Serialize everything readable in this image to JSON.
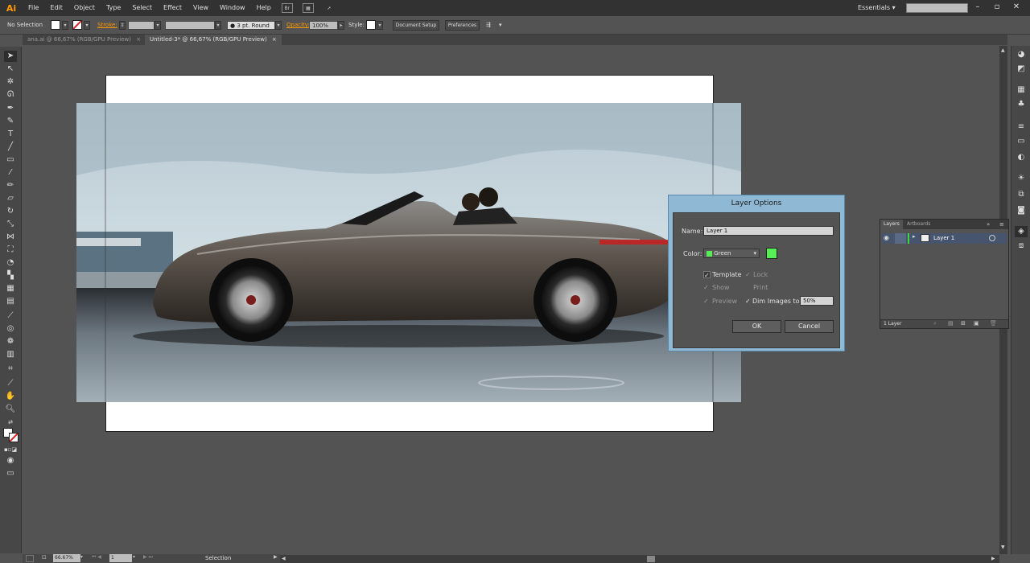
{
  "app": {
    "logo": "Ai"
  },
  "menu": [
    "File",
    "Edit",
    "Object",
    "Type",
    "Select",
    "Effect",
    "View",
    "Window",
    "Help"
  ],
  "menu_icons": {
    "bridge": "Br"
  },
  "workspace": {
    "label": "Essentials",
    "arrow": "▾"
  },
  "control_bar": {
    "selection": "No Selection",
    "stroke_label": "Stroke:",
    "brush": "3 pt. Round",
    "opacity_label": "Opacity:",
    "opacity_value": "100%",
    "style_label": "Style:",
    "document_setup": "Document Setup",
    "preferences": "Preferences"
  },
  "tabs": [
    {
      "label": "ana.ai @ 66,67% (RGB/GPU Preview)",
      "close": "×"
    },
    {
      "label": "Untitled-3* @ 66,67% (RGB/GPU Preview)",
      "close": "×"
    }
  ],
  "status": {
    "zoom": "66.67%",
    "artboard": "1",
    "tool": "Selection"
  },
  "layers_panel": {
    "tabs": [
      "Layers",
      "Artboards"
    ],
    "layer_name": "Layer 1",
    "footer": "1 Layer",
    "collapse": "»"
  },
  "dialog": {
    "title": "Layer Options",
    "name_label": "Name:",
    "name_value": "Layer 1",
    "color_label": "Color:",
    "color_value": "Green",
    "color_swatch": "#55ee55",
    "template": "Template",
    "lock": "Lock",
    "show": "Show",
    "print": "Print",
    "preview": "Preview",
    "dim_images": "Dim Images to:",
    "dim_value": "50%",
    "ok": "OK",
    "cancel": "Cancel"
  },
  "colors": {
    "accent": "#ff9a00",
    "dialog_frame": "#8eb8d4",
    "layer_highlight": "#46556d"
  }
}
